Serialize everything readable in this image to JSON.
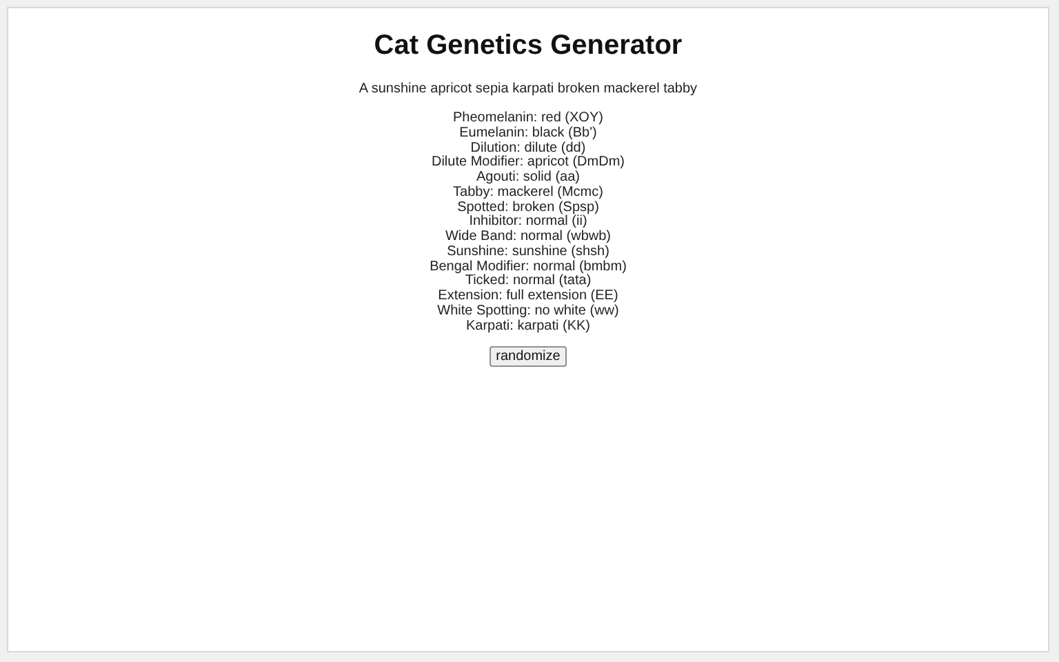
{
  "title": "Cat Genetics Generator",
  "description": "A sunshine apricot sepia karpati broken mackerel tabby",
  "genes": [
    {
      "text": "Pheomelanin: red (XOY)"
    },
    {
      "text": "Eumelanin: black (Bb')"
    },
    {
      "text": "Dilution: dilute (dd)"
    },
    {
      "text": "Dilute Modifier: apricot (DmDm)"
    },
    {
      "text": "Agouti: solid (aa)"
    },
    {
      "text": "Tabby: mackerel (Mcmc)"
    },
    {
      "text": "Spotted: broken (Spsp)"
    },
    {
      "text": "Inhibitor: normal (ii)"
    },
    {
      "text": "Wide Band: normal (wbwb)"
    },
    {
      "text": "Sunshine: sunshine (shsh)"
    },
    {
      "text": "Bengal Modifier: normal (bmbm)"
    },
    {
      "text": "Ticked: normal (tata)"
    },
    {
      "text": "Extension: full extension (EE)"
    },
    {
      "text": "White Spotting: no white (ww)"
    },
    {
      "text": "Karpati: karpati (KK)"
    }
  ],
  "button": "randomize"
}
